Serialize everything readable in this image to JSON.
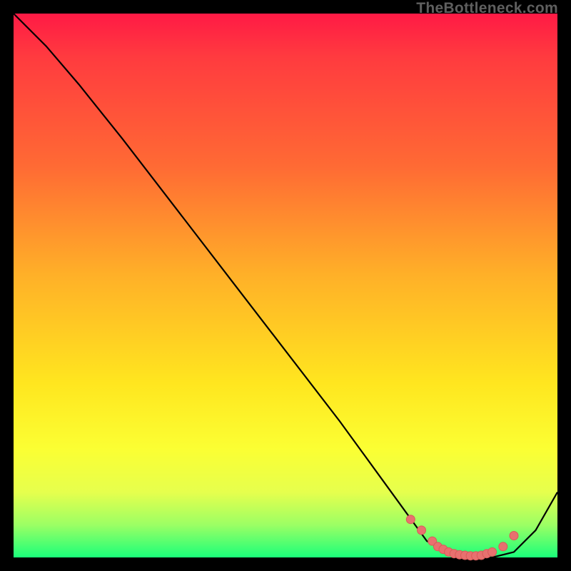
{
  "citation": "TheBottleneck.com",
  "colors": {
    "background": "#000000",
    "gradient_top": "#ff1a45",
    "gradient_mid": "#ffe61f",
    "gradient_bottom": "#1aff7a",
    "curve_stroke": "#000000",
    "marker_fill": "#e8716f",
    "marker_stroke": "#d95a59"
  },
  "chart_data": {
    "type": "line",
    "title": "",
    "xlabel": "",
    "ylabel": "",
    "xlim": [
      0,
      100
    ],
    "ylim": [
      0,
      100
    ],
    "series": [
      {
        "name": "bottleneck-curve",
        "x": [
          0,
          6,
          12,
          20,
          30,
          40,
          50,
          60,
          68,
          76,
          80,
          84,
          88,
          92,
          96,
          100
        ],
        "values": [
          100,
          94,
          87,
          77,
          64,
          51,
          38,
          25,
          14,
          3,
          1,
          0,
          0,
          1,
          5,
          12
        ]
      }
    ],
    "markers": {
      "name": "optimal-range-markers",
      "x": [
        73,
        75,
        77,
        78,
        79,
        80,
        81,
        82,
        83,
        84,
        85,
        86,
        87,
        88,
        90,
        92
      ],
      "values": [
        7,
        5,
        3,
        2,
        1.5,
        1,
        0.7,
        0.5,
        0.4,
        0.3,
        0.3,
        0.4,
        0.7,
        1,
        2,
        4
      ]
    }
  }
}
